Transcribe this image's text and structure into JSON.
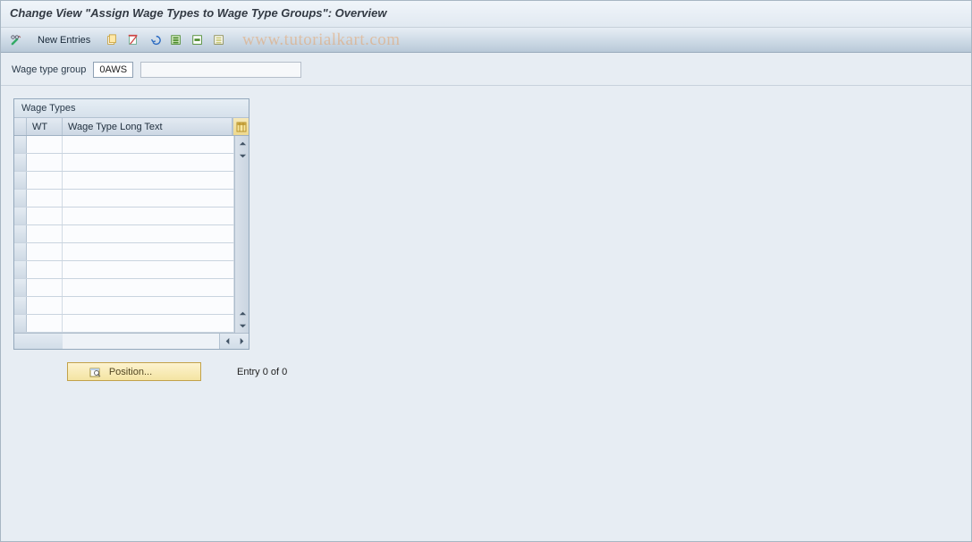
{
  "title": "Change View \"Assign Wage Types to Wage Type Groups\": Overview",
  "toolbar": {
    "new_entries_label": "New Entries"
  },
  "watermark": "www.tutorialkart.com",
  "filter": {
    "label": "Wage type group",
    "code": "0AWS",
    "desc": ""
  },
  "table": {
    "panel_title": "Wage Types",
    "col_wt": "WT",
    "col_text": "Wage Type Long Text",
    "visible_row_count": 11
  },
  "footer": {
    "position_label": "Position...",
    "entry_text": "Entry 0 of 0"
  },
  "icons": {
    "change": "change-icon",
    "copy": "copy-icon",
    "delete": "delete-icon",
    "undo": "undo-icon",
    "select_all": "select-all-icon",
    "select_block": "select-block-icon",
    "deselect_all": "deselect-all-icon"
  }
}
